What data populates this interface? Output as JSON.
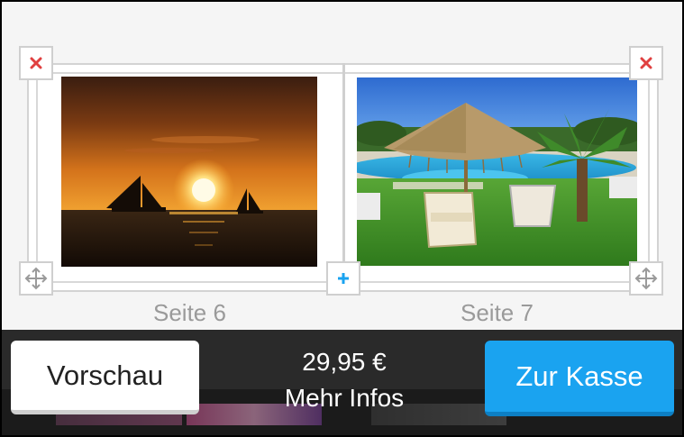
{
  "pages": [
    {
      "label": "Seite 6",
      "photo": "sunset-sailboats-photo"
    },
    {
      "label": "Seite 7",
      "photo": "pool-parasol-photo"
    }
  ],
  "controls": {
    "delete_icon": "close-icon",
    "move_icon": "move-icon",
    "add_icon": "plus-icon"
  },
  "bottom_bar": {
    "preview_label": "Vorschau",
    "price": "29,95 €",
    "more_info_label": "Mehr Infos",
    "checkout_label": "Zur Kasse"
  },
  "colors": {
    "accent": "#1aa3f0",
    "delete": "#e04040",
    "bar_background": "#2a2a2a"
  }
}
